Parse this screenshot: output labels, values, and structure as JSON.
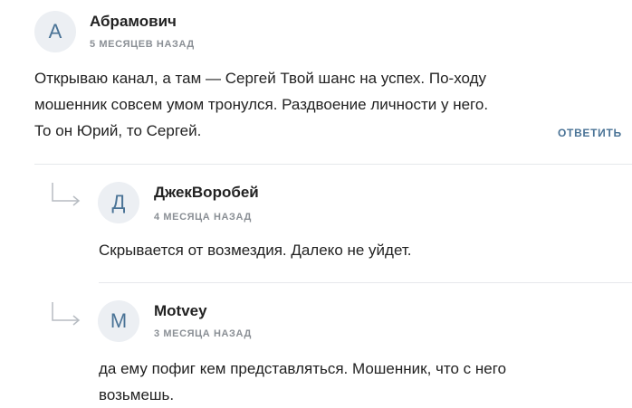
{
  "comments": [
    {
      "avatar_letter": "А",
      "author": "Абрамович",
      "time": "5 МЕСЯЦЕВ НАЗАД",
      "lines": [
        "Открываю канал, а там — Сергей Твой шанс на успех. По-ходу",
        "мошенник совсем умом тронулся. Раздвоение личности у него.",
        "То он Юрий, то Сергей."
      ],
      "reply_label": "ОТВЕТИТЬ"
    },
    {
      "avatar_letter": "Д",
      "author": "ДжекВоробей",
      "time": "4 МЕСЯЦА НАЗАД",
      "lines": [
        "Скрывается от возмездия. Далеко не уйдет."
      ]
    },
    {
      "avatar_letter": "М",
      "author": "Motvey",
      "time": "3 МЕСЯЦА НАЗАД",
      "lines": [
        "да ему пофиг кем представляться. Мошенник, что с него",
        "возьмешь."
      ]
    }
  ],
  "icons": {
    "reply_arrow": "reply-arrow-icon"
  },
  "colors": {
    "accent": "#4a7396",
    "meta": "#8a8f95",
    "avatar_bg": "#eceff3",
    "divider": "#e6e8eb"
  }
}
